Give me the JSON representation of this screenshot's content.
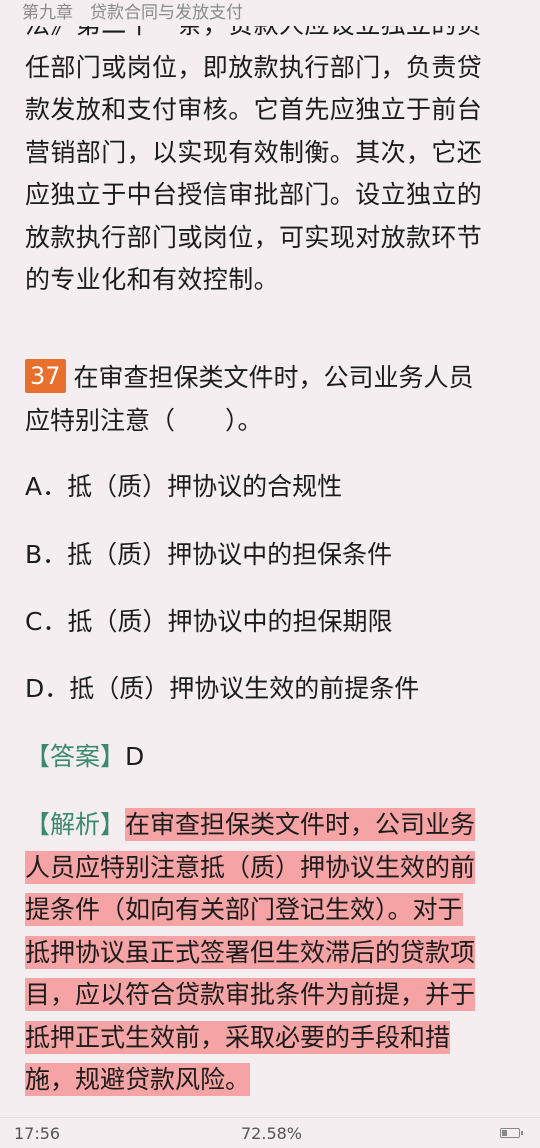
{
  "header": {
    "chapter_title": "第九章　贷款合同与发放支付"
  },
  "previous_paragraph": {
    "lines": [
      "法》第二十一条，贷款人应设立独立的负",
      "任部门或岗位，即放款执行部门，负责贷",
      "款发放和支付审核。它首先应独立于前台",
      "营销部门，以实现有效制衡。其次，它还",
      "应独立于中台授信审批部门。设立独立的",
      "放款执行部门或岗位，可实现对放款环节",
      "的专业化和有效控制。"
    ]
  },
  "question": {
    "number": "37",
    "line1": "在审查担保类文件时，公司业务人员",
    "line2": "应特别注意（　　）。",
    "options": {
      "a": "A．抵（质）押协议的合规性",
      "b": "B．抵（质）押协议中的担保条件",
      "c": "C．抵（质）押协议中的担保期限",
      "d": "D．抵（质）押协议生效的前提条件"
    }
  },
  "answer": {
    "label": "【答案】",
    "value": "D"
  },
  "analysis": {
    "label": "【解析】",
    "lines": [
      "在审查担保类文件时，公司业务",
      "人员应特别注意抵（质）押协议生效的前",
      "提条件（如向有关部门登记生效）。对于",
      "抵押协议虽正式签署但生效滞后的贷款项",
      "目，应以符合贷款审批条件为前提，并于",
      "抵押正式生效前，采取必要的手段和措",
      "施，规避贷款风险。"
    ],
    "highlight_color": "#f5a3a4"
  },
  "status_bar": {
    "time": "17:56",
    "progress": "72.58%",
    "battery_level": 0.35
  },
  "colors": {
    "background": "#f4eef0",
    "question_badge": "#e8702c",
    "label_green": "#3a8a6e",
    "highlight": "#f5a3a4"
  }
}
